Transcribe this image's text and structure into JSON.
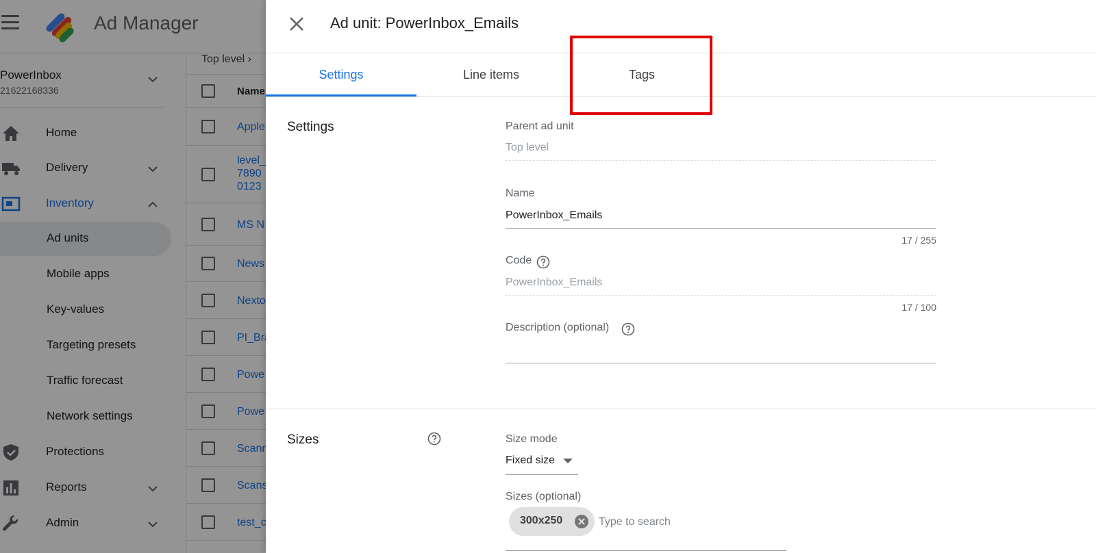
{
  "app": {
    "name": "Ad Manager",
    "network_name": "PowerInbox",
    "network_id": "21622168336"
  },
  "nav": {
    "home": "Home",
    "delivery": "Delivery",
    "inventory": "Inventory",
    "inventory_sub": [
      "Ad units",
      "Mobile apps",
      "Key-values",
      "Targeting presets",
      "Traffic forecast",
      "Network settings"
    ],
    "protections": "Protections",
    "reports": "Reports",
    "admin": "Admin"
  },
  "list": {
    "breadcrumb": "Top level  ›",
    "header": "Name",
    "rows": [
      "Apple",
      "level_\n7890\n0123",
      "MS N",
      "News",
      "Nexto",
      "PI_Bra",
      "Powe",
      "Powe",
      "Scann",
      "Scans",
      "test_c"
    ]
  },
  "panel": {
    "title": "Ad unit: PowerInbox_Emails",
    "tabs": [
      "Settings",
      "Line items",
      "Tags"
    ],
    "settings_section": "Settings",
    "parent_label": "Parent ad unit",
    "parent_value": "Top level",
    "name_label": "Name",
    "name_value": "PowerInbox_Emails",
    "name_counter": "17 / 255",
    "code_label": "Code",
    "code_value": "PowerInbox_Emails",
    "code_counter": "17 / 100",
    "description_label": "Description (optional)",
    "sizes_section": "Sizes",
    "size_mode_label": "Size mode",
    "size_mode_value": "Fixed size",
    "sizes_label": "Sizes (optional)",
    "size_chip": "300x250",
    "sizes_placeholder": "Type to search"
  },
  "colors": {
    "accent": "#1a73e8",
    "highlight": "#e00000"
  }
}
